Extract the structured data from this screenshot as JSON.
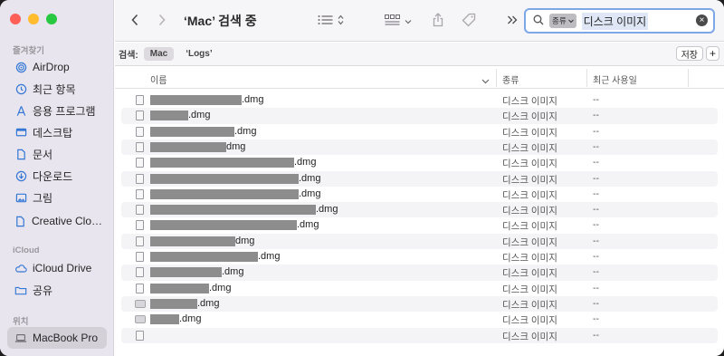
{
  "sidebar": {
    "sections": {
      "favorites": "즐겨찾기",
      "icloud": "iCloud",
      "locations": "위치"
    },
    "items": [
      {
        "label": "AirDrop",
        "icon": "airdrop-icon"
      },
      {
        "label": "최근 항목",
        "icon": "clock-icon"
      },
      {
        "label": "응용 프로그램",
        "icon": "applications-icon"
      },
      {
        "label": "데스크탑",
        "icon": "desktop-icon"
      },
      {
        "label": "문서",
        "icon": "document-icon"
      },
      {
        "label": "다운로드",
        "icon": "download-icon"
      },
      {
        "label": "그림",
        "icon": "picture-icon"
      },
      {
        "label": "Creative Cloud Files",
        "icon": "file-icon"
      },
      {
        "label": "iCloud Drive",
        "icon": "cloud-icon"
      },
      {
        "label": "공유",
        "icon": "shared-folder-icon"
      },
      {
        "label": "MacBook Pro",
        "icon": "laptop-icon"
      }
    ]
  },
  "toolbar": {
    "title": "‘Mac’ 검색 중",
    "search": {
      "token": "종류",
      "text": "디스크 이미지"
    }
  },
  "scope": {
    "label": "검색:",
    "options": [
      "Mac",
      "‘Logs’"
    ],
    "selected": "Mac",
    "save_label": "저장",
    "add_label": "+"
  },
  "columns": {
    "name": "이름",
    "kind": "종류",
    "date": "최근 사용일"
  },
  "rows": [
    {
      "ext": ".dmg",
      "kind": "디스크 이미지",
      "date": "--"
    },
    {
      "ext": ".dmg",
      "kind": "디스크 이미지",
      "date": "--"
    },
    {
      "ext": ".dmg",
      "kind": "디스크 이미지",
      "date": "--"
    },
    {
      "ext": "dmg",
      "kind": "디스크 이미지",
      "date": "--"
    },
    {
      "ext": ".dmg",
      "kind": "디스크 이미지",
      "date": "--"
    },
    {
      "ext": ".dmg",
      "kind": "디스크 이미지",
      "date": "--"
    },
    {
      "ext": ".dmg",
      "kind": "디스크 이미지",
      "date": "--"
    },
    {
      "ext": ".dmg",
      "kind": "디스크 이미지",
      "date": "--"
    },
    {
      "ext": ".dmg",
      "kind": "디스크 이미지",
      "date": "--"
    },
    {
      "ext": "dmg",
      "kind": "디스크 이미지",
      "date": "--"
    },
    {
      "ext": ".dmg",
      "kind": "디스크 이미지",
      "date": "--"
    },
    {
      "ext": ".dmg",
      "kind": "디스크 이미지",
      "date": "--"
    },
    {
      "ext": ".dmg",
      "kind": "디스크 이미지",
      "date": "--"
    },
    {
      "ext": ".dmg",
      "kind": "디스크 이미지",
      "date": "--"
    },
    {
      "ext": ".dmg",
      "kind": "디스크 이미지",
      "date": "--"
    },
    {
      "ext": "",
      "kind": "디스크 이미지",
      "date": "--"
    }
  ]
}
